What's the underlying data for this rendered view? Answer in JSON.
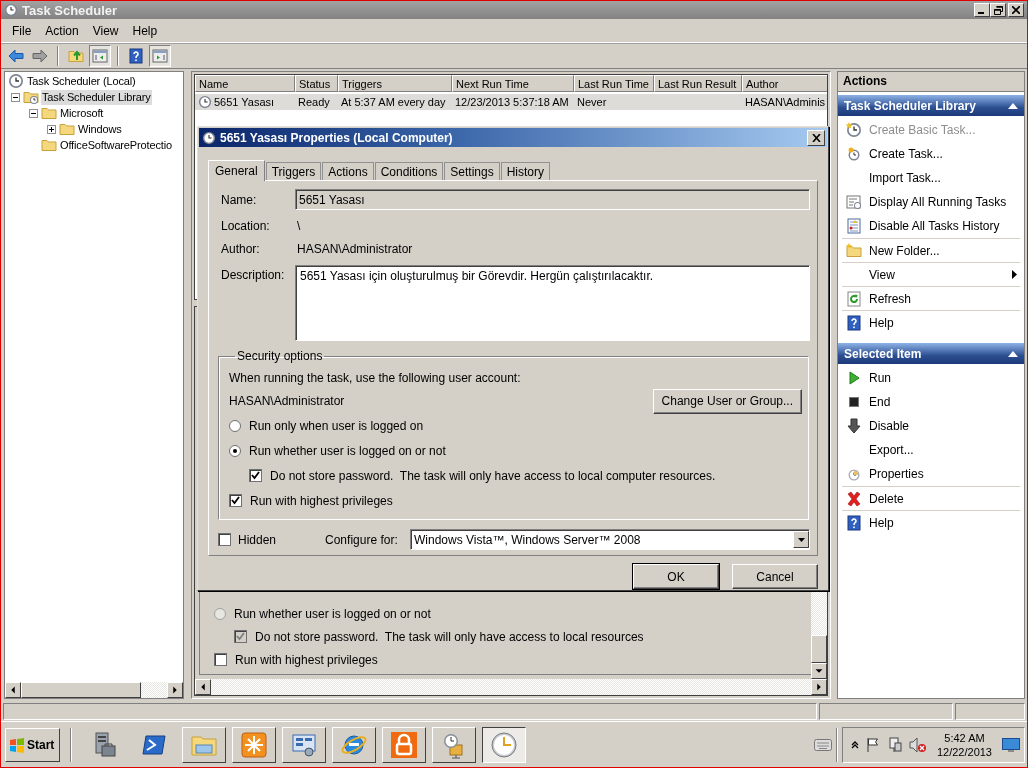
{
  "window": {
    "title": "Task Scheduler"
  },
  "menu": [
    "File",
    "Action",
    "View",
    "Help"
  ],
  "toolbar": [
    {
      "kind": "back",
      "pressed": false
    },
    {
      "kind": "forward",
      "pressed": false
    },
    {
      "kind": "up",
      "pressed": false
    },
    {
      "kind": "console-tree",
      "pressed": true
    },
    {
      "kind": "help",
      "pressed": false
    },
    {
      "kind": "action-pane",
      "pressed": true
    }
  ],
  "tree": [
    {
      "label": "Task Scheduler (Local)",
      "kind": "root",
      "selected": false,
      "children": [
        {
          "label": "Task Scheduler Library",
          "kind": "library",
          "expanded": true,
          "selected": true,
          "children": [
            {
              "label": "Microsoft",
              "kind": "folder",
              "expanded": true,
              "selected": false,
              "children": [
                {
                  "label": "Windows",
                  "kind": "folder",
                  "expanded": false,
                  "selected": false
                }
              ]
            },
            {
              "label": "OfficeSoftwareProtectio",
              "kind": "folder",
              "selected": false
            }
          ]
        }
      ]
    }
  ],
  "task_table": {
    "columns": [
      "Name",
      "Status",
      "Triggers",
      "Next Run Time",
      "Last Run Time",
      "Last Run Result",
      "Author"
    ],
    "rows": [
      {
        "selected": true,
        "cells": [
          "5651 Yasası",
          "Ready",
          "At 5:37 AM every day",
          "12/23/2013 5:37:18 AM",
          "Never",
          null,
          "HASAN\\Adminis"
        ]
      }
    ]
  },
  "preview_options": [
    {
      "kind": "radio",
      "label": "Run whether user is logged on or not",
      "checked": false,
      "disabled": true,
      "children": [
        {
          "kind": "checkbox",
          "label": "Do not store password.  The task will only have access to local resources",
          "checked": true,
          "disabled": true
        }
      ]
    },
    {
      "kind": "checkbox",
      "label": "Run with highest privileges",
      "checked": false,
      "disabled": false
    }
  ],
  "dialog": {
    "title": "5651 Yasası Properties (Local Computer)",
    "tabs": [
      {
        "label": "General",
        "selected": true
      },
      {
        "label": "Triggers",
        "selected": false
      },
      {
        "label": "Actions",
        "selected": false
      },
      {
        "label": "Conditions",
        "selected": false
      },
      {
        "label": "Settings",
        "selected": false
      },
      {
        "label": "History",
        "selected": false
      }
    ],
    "fields": [
      {
        "label": "Name:",
        "kind": "input",
        "value": "5651 Yasası"
      },
      {
        "label": "Location:",
        "kind": "text",
        "value": "\\"
      },
      {
        "label": "Author:",
        "kind": "text",
        "value": "HASAN\\Administrator"
      },
      {
        "label": "Description:",
        "kind": "textarea",
        "value": "5651 Yasası için oluşturulmuş bir Görevdir. Hergün çalıştırılacaktır."
      }
    ],
    "security": {
      "legend": "Security options",
      "prompt": "When running the task, use the following user account:",
      "account": "HASAN\\Administrator",
      "button": "Change User or Group...",
      "options": [
        {
          "kind": "radio",
          "label": "Run only when user is logged on",
          "checked": false
        },
        {
          "kind": "radio",
          "label": "Run whether user is logged on or not",
          "checked": true,
          "children": [
            {
              "kind": "checkbox",
              "label": "Do not store password.  The task will only have access to local computer resources.",
              "checked": true
            }
          ]
        },
        {
          "kind": "checkbox",
          "label": "Run with highest privileges",
          "checked": true
        }
      ]
    },
    "hidden": {
      "label": "Hidden",
      "checked": false
    },
    "configure": {
      "label": "Configure for:",
      "value": "Windows Vista™, Windows Server™ 2008"
    },
    "buttons": [
      {
        "label": "OK",
        "default": true
      },
      {
        "label": "Cancel",
        "default": false
      }
    ]
  },
  "actions": {
    "title": "Actions",
    "sections": [
      {
        "title": "Task Scheduler Library",
        "expanded": true,
        "items": [
          {
            "label": "Create Basic Task...",
            "kind": "clock-star",
            "disabled": true,
            "separated": false
          },
          {
            "label": "Create Task...",
            "kind": "clock-small",
            "disabled": false,
            "separated": false
          },
          {
            "label": "Import Task...",
            "kind": "none",
            "disabled": false,
            "separated": false
          },
          {
            "label": "Display All Running Tasks",
            "kind": "running",
            "disabled": false,
            "separated": false
          },
          {
            "label": "Disable All Tasks History",
            "kind": "history",
            "disabled": false,
            "separated": false
          },
          {
            "label": "New Folder...",
            "kind": "new-folder",
            "disabled": false,
            "separated": true
          },
          {
            "label": "View",
            "kind": "submenu",
            "disabled": false,
            "separated": true
          },
          {
            "label": "Refresh",
            "kind": "refresh",
            "disabled": false,
            "separated": true
          },
          {
            "label": "Help",
            "kind": "help",
            "disabled": false,
            "separated": true
          }
        ]
      },
      {
        "title": "Selected Item",
        "expanded": true,
        "items": [
          {
            "label": "Run",
            "kind": "run",
            "disabled": false,
            "separated": false
          },
          {
            "label": "End",
            "kind": "end",
            "disabled": false,
            "separated": false
          },
          {
            "label": "Disable",
            "kind": "disable",
            "disabled": false,
            "separated": false
          },
          {
            "label": "Export...",
            "kind": "none",
            "disabled": false,
            "separated": false
          },
          {
            "label": "Properties",
            "kind": "properties",
            "disabled": false,
            "separated": false
          },
          {
            "label": "Delete",
            "kind": "delete",
            "disabled": false,
            "separated": true
          },
          {
            "label": "Help",
            "kind": "help",
            "disabled": false,
            "separated": true
          }
        ]
      }
    ]
  },
  "taskbar": {
    "start": "Start",
    "apps": [
      {
        "kind": "server",
        "running": false,
        "selected": false
      },
      {
        "kind": "shell",
        "running": false,
        "selected": false
      },
      {
        "kind": "explorer",
        "running": true,
        "selected": false
      },
      {
        "kind": "tile",
        "running": true,
        "selected": false
      },
      {
        "kind": "control-panel",
        "running": true,
        "selected": false
      },
      {
        "kind": "browser",
        "running": true,
        "selected": false
      },
      {
        "kind": "lock",
        "running": true,
        "selected": false
      },
      {
        "kind": "folder-clock",
        "running": true,
        "selected": false
      },
      {
        "kind": "clock",
        "running": true,
        "selected": true
      }
    ],
    "clock": {
      "time": "5:42 AM",
      "date": "12/22/2013"
    }
  }
}
